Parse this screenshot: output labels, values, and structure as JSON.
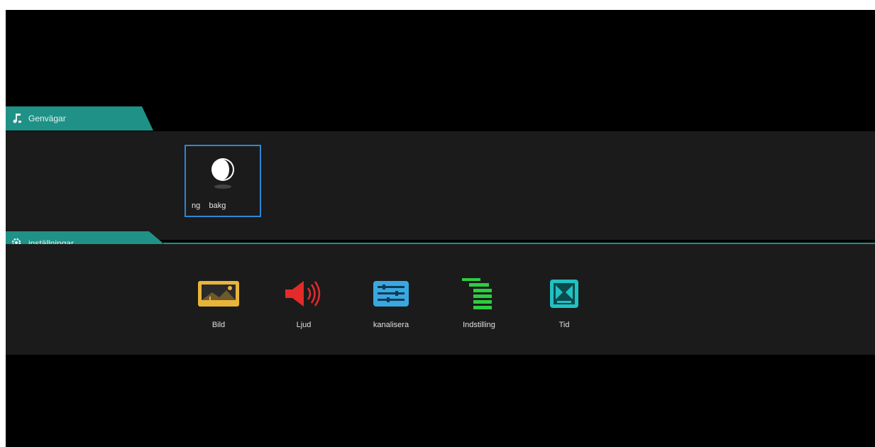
{
  "sections": {
    "shortcuts": {
      "title": "Genvägar",
      "icon": "music-note-icon"
    },
    "settings": {
      "title": "inställningar",
      "icon": "gear-icon"
    }
  },
  "shortcut_tile": {
    "label": "ng    bakg",
    "icon": "moon-icon",
    "selected": true
  },
  "settings_items": [
    {
      "label": "Bild",
      "icon": "picture-icon",
      "color": "#e8b53a"
    },
    {
      "label": "Ljud",
      "icon": "speaker-icon",
      "color": "#e52a2a"
    },
    {
      "label": "kanalisera",
      "icon": "channel-icon",
      "color": "#3aa8e0"
    },
    {
      "label": "Indstilling",
      "icon": "list-icon",
      "color": "#2ecc40"
    },
    {
      "label": "Tid",
      "icon": "clock-grid-icon",
      "color": "#22c1c3"
    }
  ],
  "colors": {
    "accent": "#1f9187",
    "focus": "#2f86d4",
    "panel": "#1b1b1b"
  }
}
